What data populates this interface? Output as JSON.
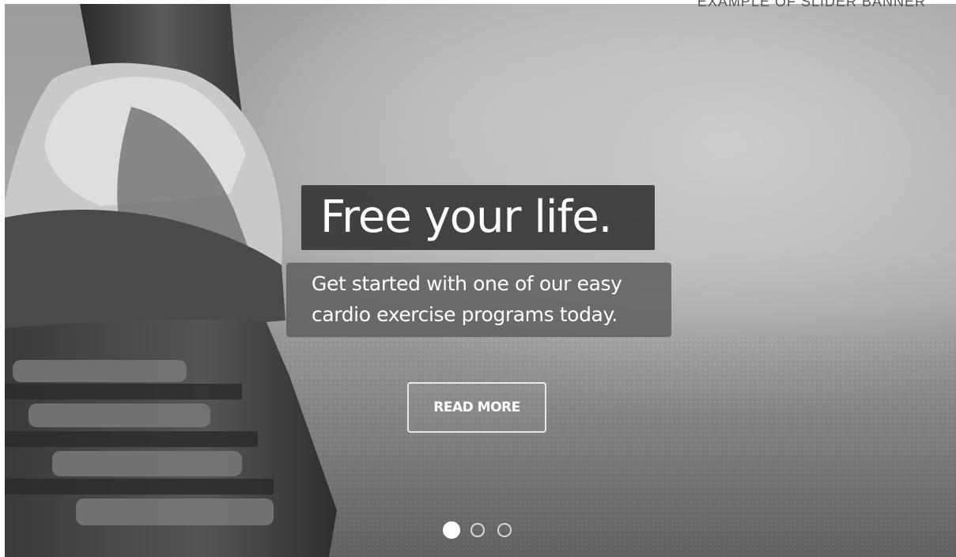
{
  "caption": "EXAMPLE OF SLIDER BANNER",
  "slide": {
    "headline": "Free your life.",
    "subtitle_lines": [
      "Get started with one of our easy",
      "cardio exercise programs today."
    ],
    "cta_label": "READ MORE"
  },
  "pagination": {
    "total": 3,
    "active_index": 0
  }
}
